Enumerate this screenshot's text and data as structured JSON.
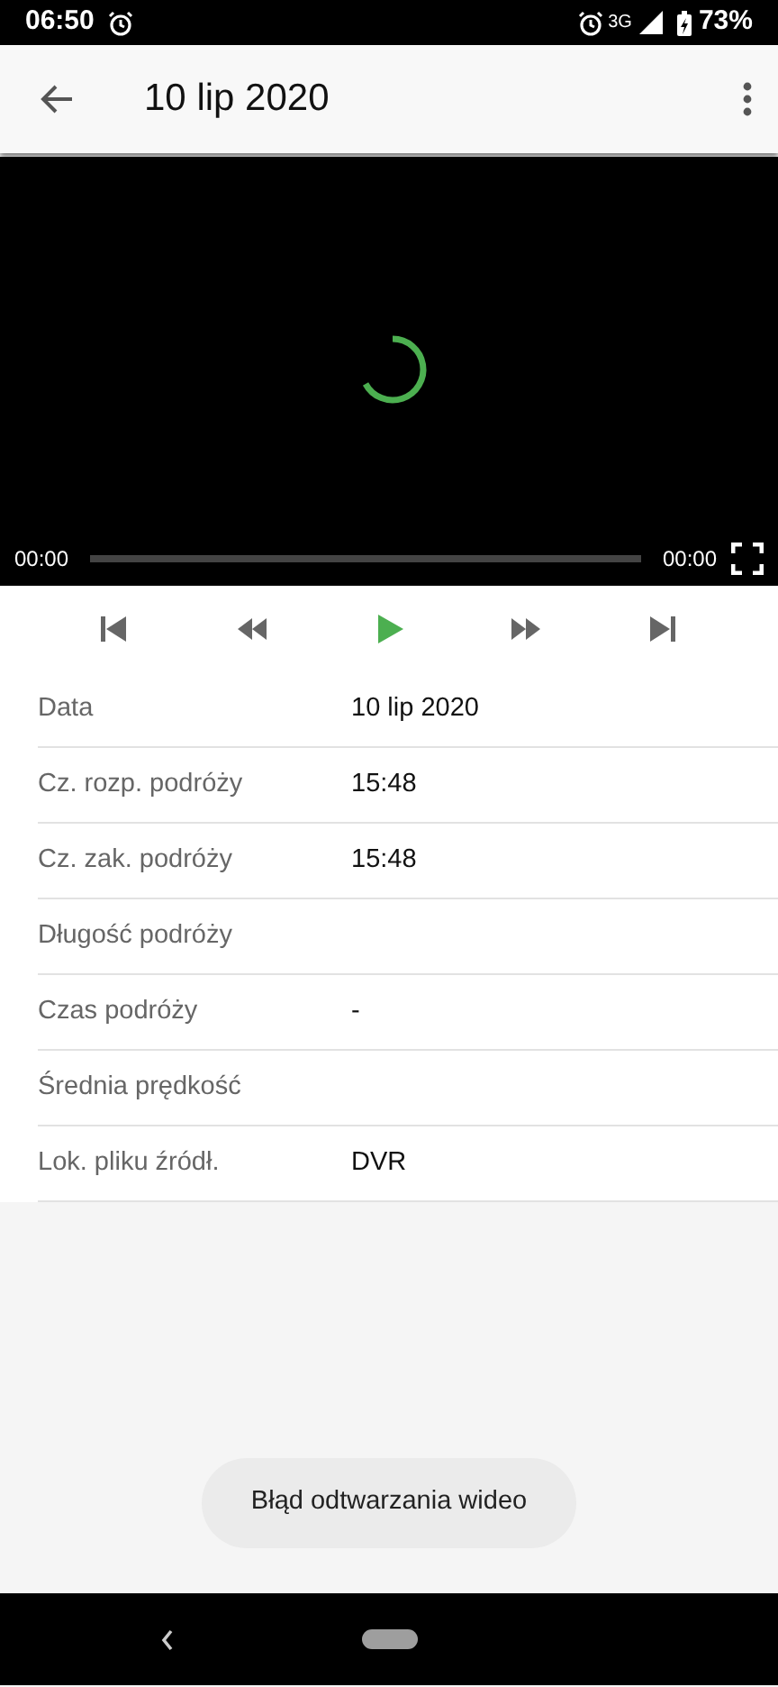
{
  "status_bar": {
    "time": "06:50",
    "network": "3G",
    "battery": "73%"
  },
  "app_bar": {
    "title": "10 lip 2020"
  },
  "player": {
    "current_time": "00:00",
    "duration": "00:00"
  },
  "controls": [
    {
      "kind": "previous"
    },
    {
      "kind": "rewind"
    },
    {
      "kind": "play"
    },
    {
      "kind": "forward"
    },
    {
      "kind": "next"
    }
  ],
  "details": [
    {
      "label": "Data",
      "value": "10 lip 2020"
    },
    {
      "label": "Cz. rozp. podróży",
      "value": "15:48"
    },
    {
      "label": "Cz. zak. podróży",
      "value": "15:48"
    },
    {
      "label": "Długość podróży"
    },
    {
      "label": "Czas podróży",
      "value": "-"
    },
    {
      "label": "Średnia prędkość"
    },
    {
      "label": "Lok. pliku źródł.",
      "value": "DVR"
    }
  ],
  "toast": "Błąd odtwarzania wideo"
}
